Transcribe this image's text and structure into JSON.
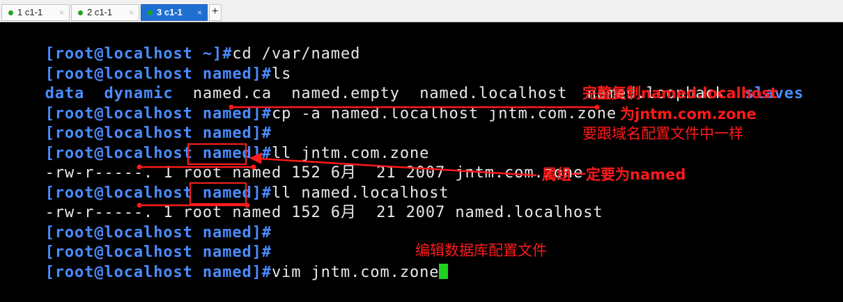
{
  "tabs": [
    {
      "label": "1 c1-1",
      "close": "×",
      "active": false
    },
    {
      "label": "2 c1-1",
      "close": "×",
      "active": false
    },
    {
      "label": "3 c1-1",
      "close": "×",
      "active": true
    }
  ],
  "new_tab": "+",
  "terminal": {
    "lines": [
      {
        "prompt": "[root@localhost ~]#",
        "text": "cd /var/named"
      },
      {
        "prompt": "[root@localhost named]#",
        "text": "ls"
      },
      {
        "ls": [
          "data",
          "dynamic",
          "named.ca",
          "named.empty",
          "named.localhost",
          "named.loopback",
          "slaves"
        ]
      },
      {
        "prompt": "[root@localhost named]#",
        "text": "cp -a named.localhost jntm.com.zone"
      },
      {
        "prompt": "[root@localhost named]#",
        "text": ""
      },
      {
        "prompt": "[root@localhost named]#",
        "text": "ll jntm.com.zone"
      },
      {
        "pre": "-rw-r-----. 1 root ",
        "group": "named",
        "post": " 152 6月  21 2007 jntm.com.zone"
      },
      {
        "prompt": "[root@localhost named]#",
        "text": "ll named.localhost"
      },
      {
        "pre": "-rw-r-----. 1 root ",
        "group": "named",
        "post": " 152 6月  21 2007 named.localhost"
      },
      {
        "prompt": "[root@localhost named]#",
        "text": ""
      },
      {
        "prompt": "[root@localhost named]#",
        "text": ""
      },
      {
        "prompt": "[root@localhost named]#",
        "text": "vim jntm.com.zone"
      }
    ]
  },
  "annotations": {
    "copy_line1": "完整复制named.localhost",
    "copy_line2": "为jntm.com.zone",
    "copy_line3": "要跟域名配置文件中一样",
    "group": "属组一定要为named",
    "edit": "编辑数据库配置文件"
  },
  "colors": {
    "prompt": "#4b8cff",
    "annotation": "#ff1a1a",
    "cursor": "#1fd11f",
    "active_tab": "#1f6fd1"
  }
}
